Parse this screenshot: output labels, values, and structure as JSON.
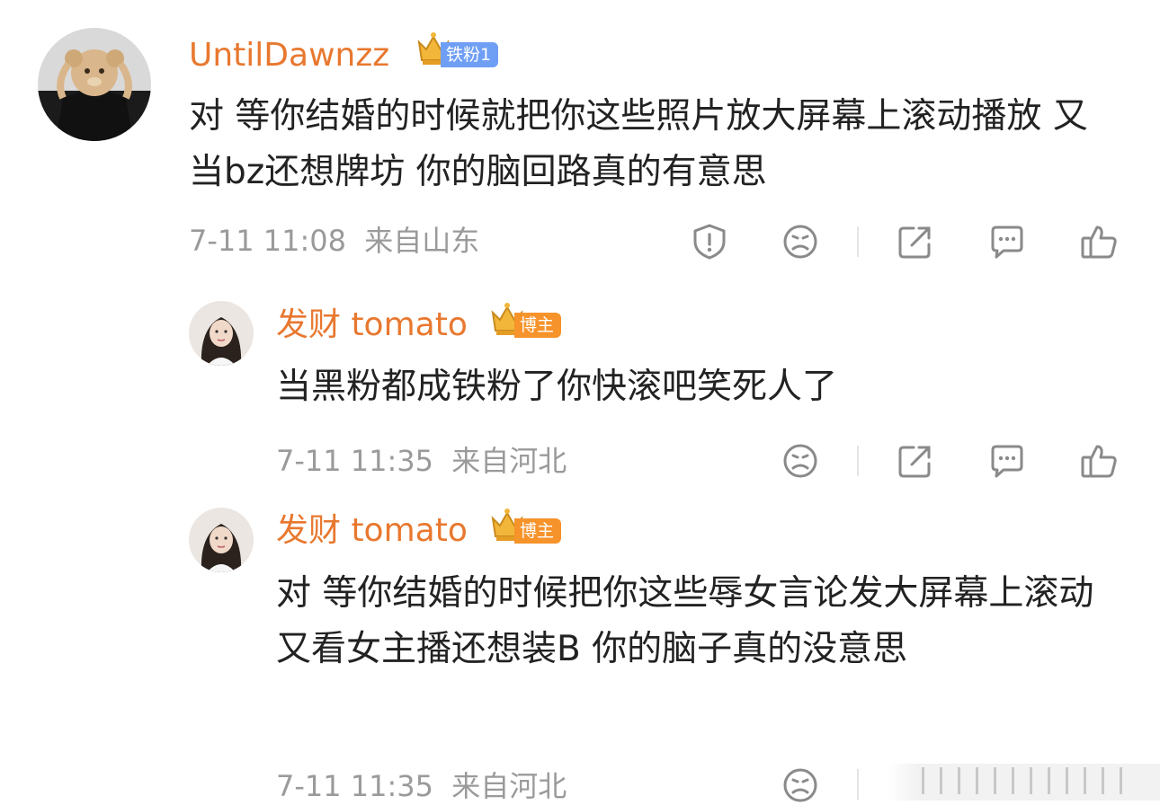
{
  "comments": [
    {
      "username": "UntilDawnzz",
      "badge": "铁粉1",
      "text": "对 等你结婚的时候就把你这些照片放大屏幕上滚动播放 又当bz还想牌坊 你的脑回路真的有意思",
      "time": "7-11 11:08",
      "location": "来自山东"
    },
    {
      "username": "发财 tomato",
      "badge": "博主",
      "text": "当黑粉都成铁粉了你快滚吧笑死人了",
      "time": "7-11 11:35",
      "location": "来自河北"
    },
    {
      "username": "发财 tomato",
      "badge": "博主",
      "text": "对 等你结婚的时候把你这些辱女言论发大屏幕上滚动 又看女主播还想装B 你的脑子真的没意思",
      "time": "7-11 11:35",
      "location": "来自河北"
    }
  ],
  "colors": {
    "username": "#e8782f",
    "fan_badge": "#6f9ef5",
    "host_badge": "#f7932b",
    "meta": "#9a9a9a"
  },
  "icons": [
    "report-icon",
    "dislike-face-icon",
    "share-icon",
    "comment-icon",
    "like-thumb-icon"
  ]
}
